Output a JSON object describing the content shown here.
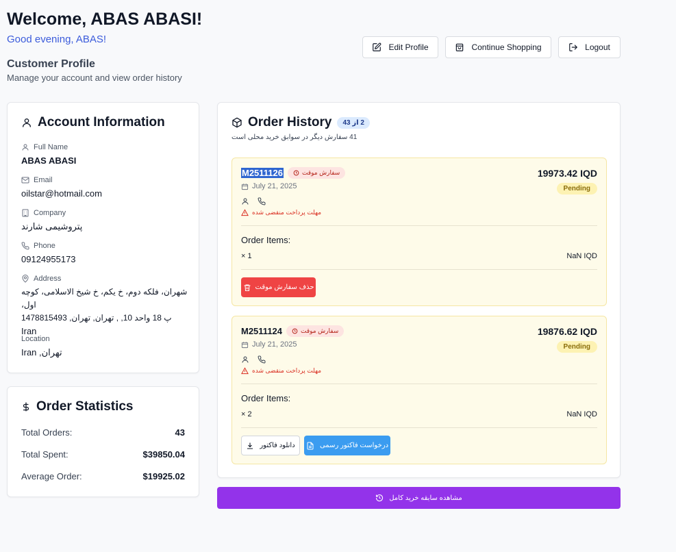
{
  "header": {
    "welcome": "Welcome, ABAS ABASI!",
    "greeting": "Good evening, ABAS!",
    "profile_title": "Customer Profile",
    "profile_subtitle": "Manage your account and view order history",
    "edit_profile": "Edit Profile",
    "continue_shopping": "Continue Shopping",
    "logout": "Logout"
  },
  "account": {
    "title": "Account Information",
    "full_name_label": "Full Name",
    "full_name": "ABAS ABASI",
    "email_label": "Email",
    "email": "oilstar@hotmail.com",
    "company_label": "Company",
    "company": "پتروشیمی شارند",
    "phone_label": "Phone",
    "phone": "09124955173",
    "address_label": "Address",
    "address_line1": "شهران، فلکه دوم، خ یکم، خ شیخ الاسلامی، کوچه اول،",
    "address_line2": "پ 18 واحد 10, , تهران, تهران, 1478815493",
    "address_line3": "Iran",
    "location_label": "Location",
    "location": "تهران, Iran"
  },
  "stats": {
    "title": "Order Statistics",
    "total_orders_label": "Total Orders:",
    "total_orders": "43",
    "total_spent_label": "Total Spent:",
    "total_spent": "$39850.04",
    "average_order_label": "Average Order:",
    "average_order": "$19925.02"
  },
  "orders": {
    "title": "Order History",
    "count_badge": "2 از 43",
    "note": "41 سفارش دیگر در سوابق خرید محلی است",
    "list": [
      {
        "id": "M2511126",
        "temp_badge": "سفارش موقت",
        "date": "July 21, 2025",
        "price": "19973.42 IQD",
        "status": "Pending",
        "expired": "مهلت پرداخت منقضی شده",
        "items_title": "Order Items:",
        "qty": "× 1",
        "item_price": "NaN IQD",
        "delete_label": "حذف سفارش موقت"
      },
      {
        "id": "M2511124",
        "temp_badge": "سفارش موقت",
        "date": "July 21, 2025",
        "price": "19876.62 IQD",
        "status": "Pending",
        "expired": "مهلت پرداخت منقضی شده",
        "items_title": "Order Items:",
        "qty": "× 2",
        "item_price": "NaN IQD",
        "download_label": "دانلود فاکتور",
        "request_label": "درخواست فاکتور رسمی"
      }
    ],
    "view_full_history": "مشاهده سابقه خرید کامل"
  },
  "colors": {
    "accent_blue": "#3b5bdb",
    "danger": "#ef4444",
    "purple": "#9333ea",
    "pending_bg": "#fdf2b3"
  }
}
